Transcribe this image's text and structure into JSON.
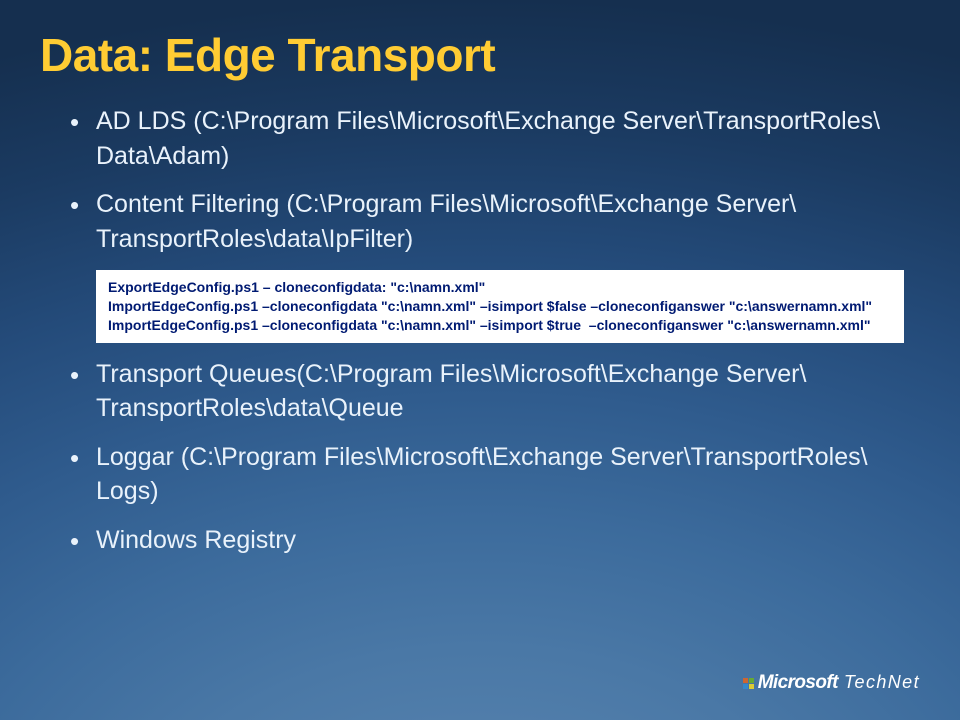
{
  "title": "Data: Edge Transport",
  "bullets": {
    "b1": "AD LDS (C:\\Program Files\\Microsoft\\Exchange Server\\TransportRoles\\ Data\\Adam)",
    "b2": "Content Filtering (C:\\Program Files\\Microsoft\\Exchange Server\\ TransportRoles\\data\\IpFilter)",
    "b3": "Transport Queues(C:\\Program Files\\Microsoft\\Exchange Server\\ TransportRoles\\data\\Queue",
    "b4": "Loggar (C:\\Program Files\\Microsoft\\Exchange Server\\TransportRoles\\ Logs)",
    "b5": "Windows Registry"
  },
  "code": "ExportEdgeConfig.ps1 – cloneconfigdata: \"c:\\namn.xml\"\nImportEdgeConfig.ps1 –cloneconfigdata \"c:\\namn.xml\" –isimport $false –cloneconfiganswer \"c:\\answernamn.xml\"\nImportEdgeConfig.ps1 –cloneconfigdata \"c:\\namn.xml\" –isimport $true  –cloneconfiganswer \"c:\\answernamn.xml\"",
  "footer": {
    "brand_bold": "Microsoft",
    "brand_light": "TechNet"
  }
}
